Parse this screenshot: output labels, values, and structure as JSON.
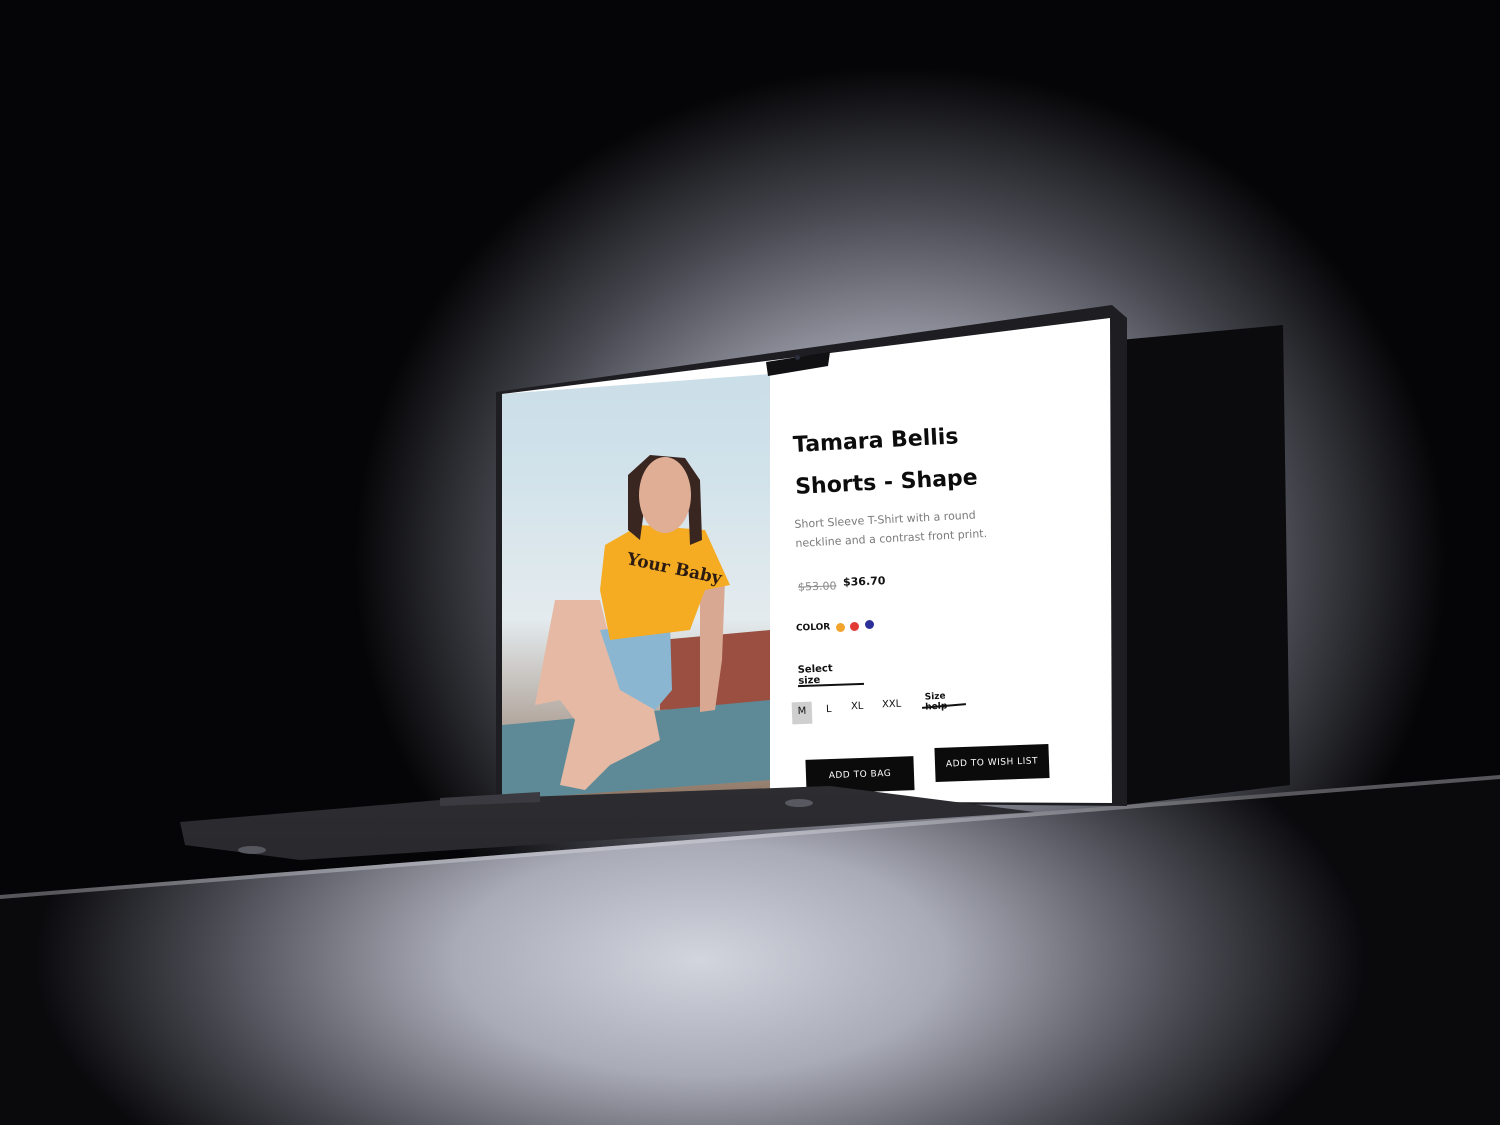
{
  "product": {
    "title": "Tamara Bellis Shorts - Shape",
    "description": "Short Sleeve T-Shirt with a round neckline and a contrast front print.",
    "price_original": "$53.00",
    "price_sale": "$36.70",
    "shirt_print": "Your Baby"
  },
  "color": {
    "label": "COLOR",
    "swatches": [
      "#f2a52a",
      "#e23b33",
      "#2b2f9a"
    ]
  },
  "size": {
    "select_label": "Select size",
    "options": [
      "M",
      "L",
      "XL",
      "XXL"
    ],
    "selected": "M",
    "help_label": "Size help"
  },
  "actions": {
    "add_to_bag": "ADD TO BAG",
    "add_to_wishlist": "ADD TO WISH LIST"
  }
}
